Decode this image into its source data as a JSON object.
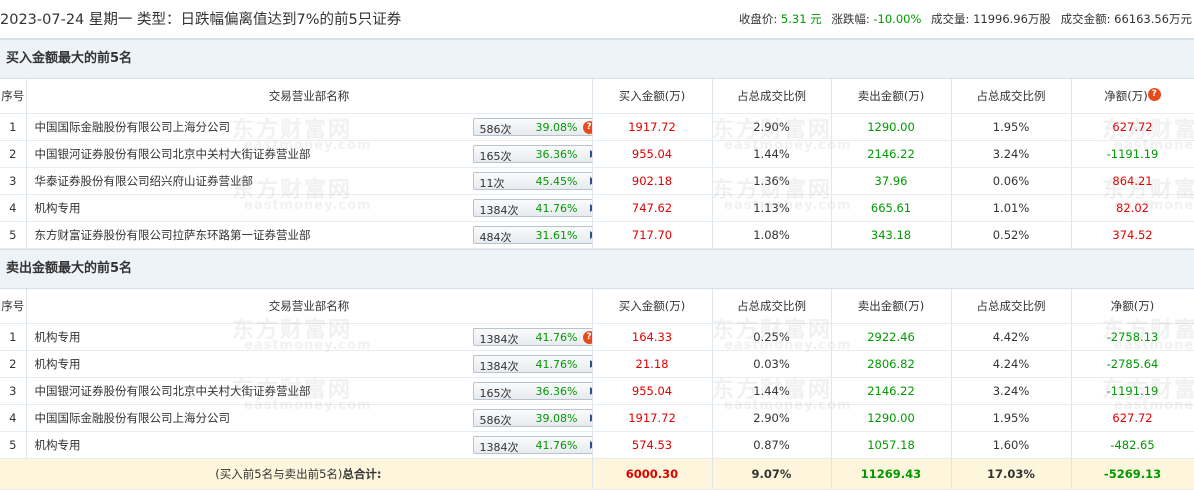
{
  "header": {
    "title": "2023-07-24 星期一 类型：日跌幅偏离值达到7%的前5只证券",
    "close_label": "收盘价:",
    "close_value": "5.31 元",
    "change_label": "涨跌幅:",
    "change_value": "-10.00%",
    "volume_label": "成交量:",
    "volume_value": "11996.96万股",
    "amount_label": "成交金额:",
    "amount_value": "66163.56万元"
  },
  "columns": [
    "序号",
    "交易营业部名称",
    "买入金额(万)",
    "占总成交比例",
    "卖出金额(万)",
    "占总成交比例",
    "净额(万)"
  ],
  "watermark": {
    "cn": "东方财富网",
    "en": "eastmoney.com"
  },
  "buy_section": {
    "title": "买入金额最大的前5名",
    "rows": [
      {
        "no": "1",
        "name": "中国国际金融股份有限公司上海分公司",
        "count": "586次",
        "pct": "39.08%",
        "buy": "1917.72",
        "buy_ratio": "2.90%",
        "sell": "1290.00",
        "sell_ratio": "1.95%",
        "net": "627.72"
      },
      {
        "no": "2",
        "name": "中国银河证券股份有限公司北京中关村大街证券营业部",
        "count": "165次",
        "pct": "36.36%",
        "buy": "955.04",
        "buy_ratio": "1.44%",
        "sell": "2146.22",
        "sell_ratio": "3.24%",
        "net": "-1191.19"
      },
      {
        "no": "3",
        "name": "华泰证券股份有限公司绍兴府山证券营业部",
        "count": "11次",
        "pct": "45.45%",
        "buy": "902.18",
        "buy_ratio": "1.36%",
        "sell": "37.96",
        "sell_ratio": "0.06%",
        "net": "864.21"
      },
      {
        "no": "4",
        "name": "机构专用",
        "count": "1384次",
        "pct": "41.76%",
        "buy": "747.62",
        "buy_ratio": "1.13%",
        "sell": "665.61",
        "sell_ratio": "1.01%",
        "net": "82.02"
      },
      {
        "no": "5",
        "name": "东方财富证券股份有限公司拉萨东环路第一证券营业部",
        "count": "484次",
        "pct": "31.61%",
        "buy": "717.70",
        "buy_ratio": "1.08%",
        "sell": "343.18",
        "sell_ratio": "0.52%",
        "net": "374.52"
      }
    ]
  },
  "sell_section": {
    "title": "卖出金额最大的前5名",
    "rows": [
      {
        "no": "1",
        "name": "机构专用",
        "count": "1384次",
        "pct": "41.76%",
        "buy": "164.33",
        "buy_ratio": "0.25%",
        "sell": "2922.46",
        "sell_ratio": "4.42%",
        "net": "-2758.13"
      },
      {
        "no": "2",
        "name": "机构专用",
        "count": "1384次",
        "pct": "41.76%",
        "buy": "21.18",
        "buy_ratio": "0.03%",
        "sell": "2806.82",
        "sell_ratio": "4.24%",
        "net": "-2785.64"
      },
      {
        "no": "3",
        "name": "中国银河证券股份有限公司北京中关村大街证券营业部",
        "count": "165次",
        "pct": "36.36%",
        "buy": "955.04",
        "buy_ratio": "1.44%",
        "sell": "2146.22",
        "sell_ratio": "3.24%",
        "net": "-1191.19"
      },
      {
        "no": "4",
        "name": "中国国际金融股份有限公司上海分公司",
        "count": "586次",
        "pct": "39.08%",
        "buy": "1917.72",
        "buy_ratio": "2.90%",
        "sell": "1290.00",
        "sell_ratio": "1.95%",
        "net": "627.72"
      },
      {
        "no": "5",
        "name": "机构专用",
        "count": "1384次",
        "pct": "41.76%",
        "buy": "574.53",
        "buy_ratio": "0.87%",
        "sell": "1057.18",
        "sell_ratio": "1.60%",
        "net": "-482.65"
      }
    ]
  },
  "total": {
    "label_prefix": "(买入前5名与卖出前5名)",
    "label_bold": "总合计:",
    "buy": "6000.30",
    "buy_ratio": "9.07%",
    "sell": "11269.43",
    "sell_ratio": "17.03%",
    "net": "-5269.13"
  },
  "colors": {
    "up": "#e00000",
    "down": "#009900",
    "section_bg": "#eef3f8",
    "total_bg": "#fdf6dc",
    "help_icon": "#e8491d"
  },
  "icons": {
    "expand": "triangle-right-icon",
    "help": "question-bubble-icon"
  }
}
